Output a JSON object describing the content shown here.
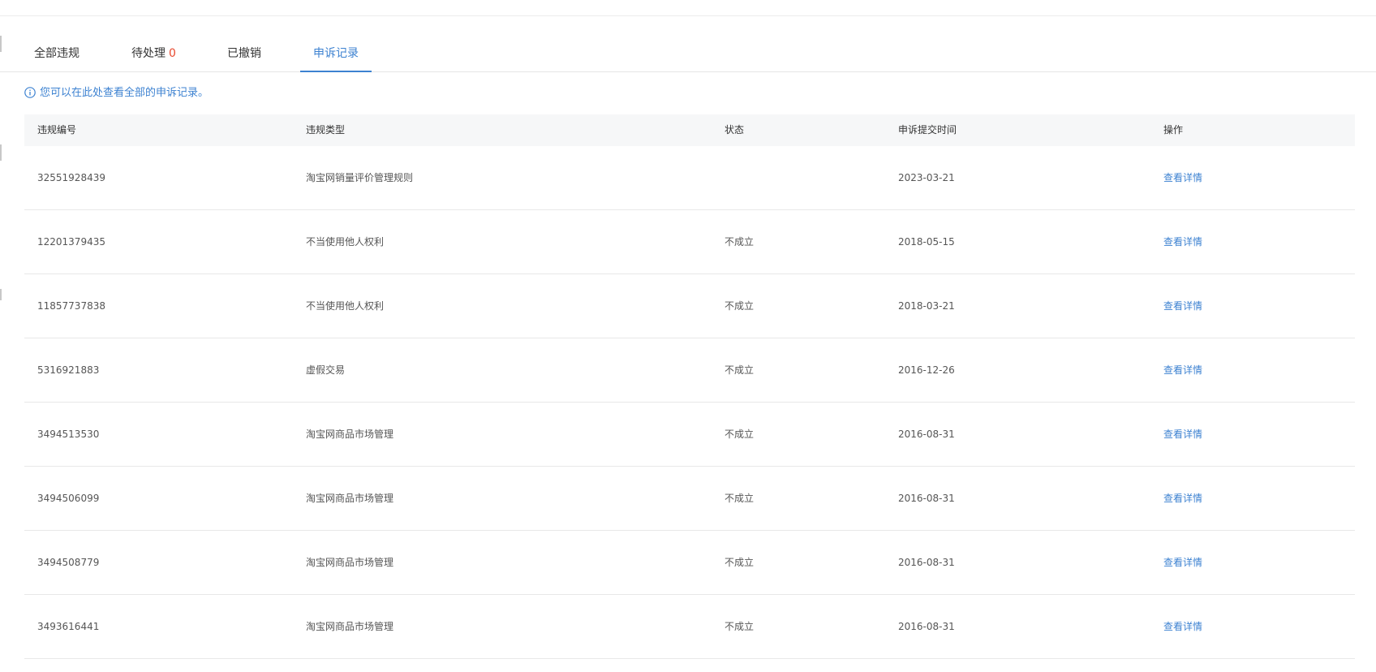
{
  "tabs": [
    {
      "label": "全部违规",
      "badge": ""
    },
    {
      "label": "待处理",
      "badge": "0"
    },
    {
      "label": "已撤销",
      "badge": ""
    },
    {
      "label": "申诉记录",
      "badge": ""
    }
  ],
  "active_tab": "申诉记录",
  "notice": {
    "icon": "info-icon",
    "text": "您可以在此处查看全部的申诉记录。"
  },
  "table": {
    "headers": [
      "违规编号",
      "违规类型",
      "状态",
      "申诉提交时间",
      "操作"
    ],
    "rows": [
      {
        "id": "32551928439",
        "type": "淘宝网销量评价管理规则",
        "status": "",
        "date": "2023-03-21",
        "action": "查看详情"
      },
      {
        "id": "12201379435",
        "type": "不当使用他人权利",
        "status": "不成立",
        "date": "2018-05-15",
        "action": "查看详情"
      },
      {
        "id": "11857737838",
        "type": "不当使用他人权利",
        "status": "不成立",
        "date": "2018-03-21",
        "action": "查看详情"
      },
      {
        "id": "5316921883",
        "type": "虚假交易",
        "status": "不成立",
        "date": "2016-12-26",
        "action": "查看详情"
      },
      {
        "id": "3494513530",
        "type": "淘宝网商品市场管理",
        "status": "不成立",
        "date": "2016-08-31",
        "action": "查看详情"
      },
      {
        "id": "3494506099",
        "type": "淘宝网商品市场管理",
        "status": "不成立",
        "date": "2016-08-31",
        "action": "查看详情"
      },
      {
        "id": "3494508779",
        "type": "淘宝网商品市场管理",
        "status": "不成立",
        "date": "2016-08-31",
        "action": "查看详情"
      },
      {
        "id": "3493616441",
        "type": "淘宝网商品市场管理",
        "status": "不成立",
        "date": "2016-08-31",
        "action": "查看详情"
      }
    ]
  },
  "colors": {
    "accent": "#3d82d1",
    "badge": "#e8492f",
    "header_bg": "#f6f7f8",
    "divider": "#e8e8e8"
  }
}
